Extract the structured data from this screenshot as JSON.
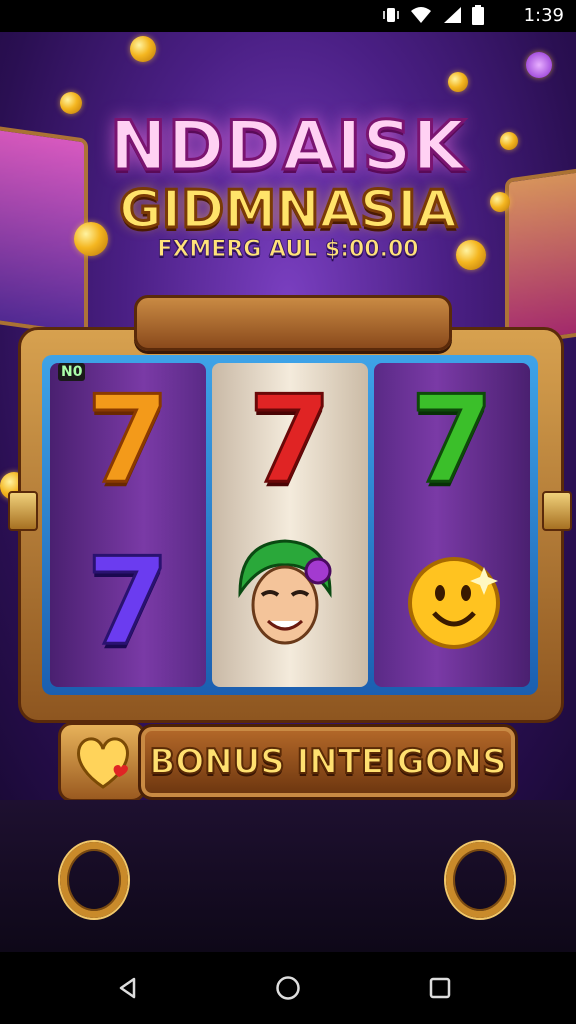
{
  "status_bar": {
    "time": "1:39",
    "icons": [
      "vibrate-icon",
      "wifi-icon",
      "signal-icon",
      "battery-icon"
    ]
  },
  "header": {
    "title_line1": "NDDAISK",
    "title_line2": "GIDMNASIA",
    "subtitle": "FXMERG AUL $:00.00"
  },
  "machine": {
    "counter_badge": "N0",
    "reels": [
      {
        "top": "7",
        "top_color": "#f39a1a",
        "bottom": "7",
        "bottom_color": "#6b3cf0"
      },
      {
        "top": "7",
        "top_color": "#e02424",
        "bottom": "jester-face-symbol"
      },
      {
        "top": "7",
        "top_color": "#3bbf2a",
        "bottom": "smiley-coin-symbol"
      }
    ]
  },
  "bonus": {
    "label": "BONUS INTEIGONS",
    "icon": "heart-icon"
  },
  "navigation": {
    "back": "back-icon",
    "home": "home-icon",
    "recent": "recent-apps-icon"
  },
  "colors": {
    "background": "#4a1f84",
    "gold": "#ffd35a",
    "frame_wood": "#8e5620",
    "title_pink": "#ff7ad9"
  }
}
